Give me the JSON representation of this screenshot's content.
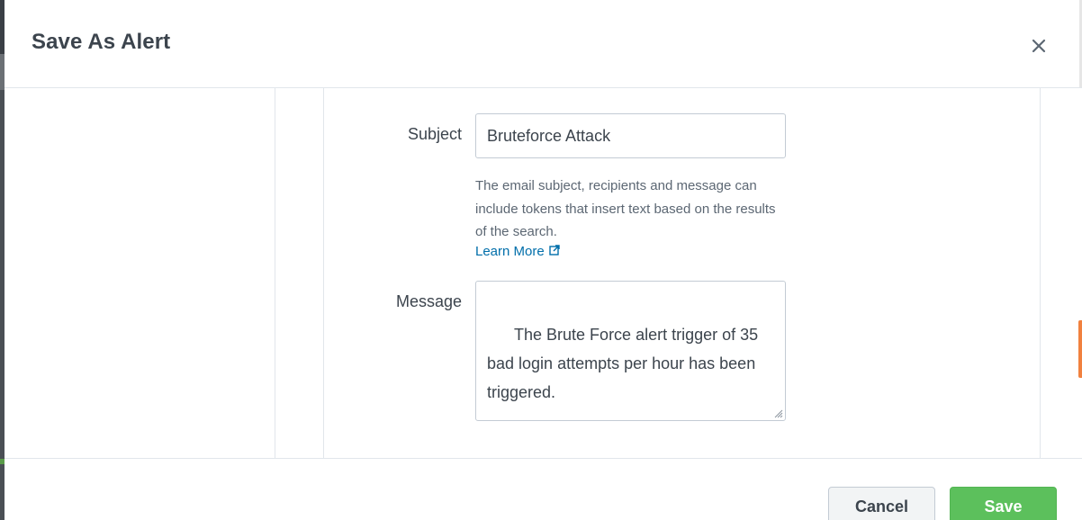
{
  "modal": {
    "title": "Save As Alert",
    "close_icon": "close-icon"
  },
  "form": {
    "subject_label": "Subject",
    "subject_value": "Bruteforce Attack",
    "help_text": "The email subject, recipients and message can include tokens that insert text based on the results of the search.",
    "learn_more": "Learn More",
    "learn_more_icon": "external-link-icon",
    "message_label": "Message",
    "message_value": "The Brute Force alert trigger of 35 bad login attempts per hour has been triggered."
  },
  "footer": {
    "cancel_label": "Cancel",
    "save_label": "Save"
  },
  "colors": {
    "save_button": "#5cc05c",
    "link": "#006eaa",
    "accent_tab": "#f1813f"
  }
}
